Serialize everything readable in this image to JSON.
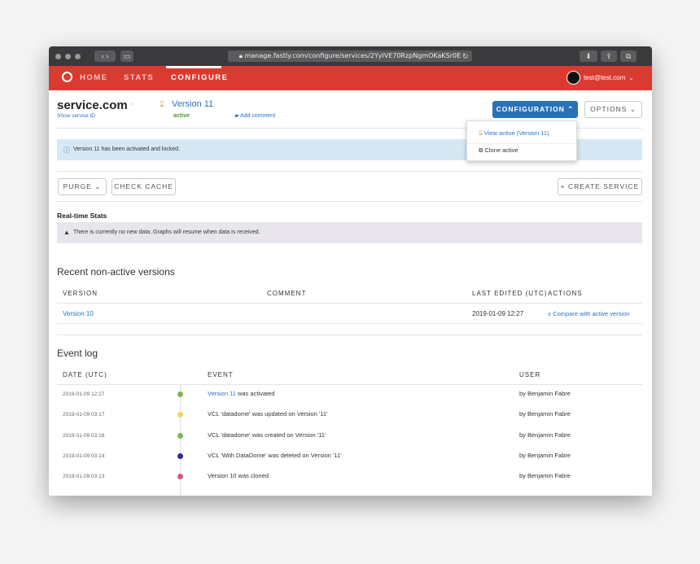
{
  "browser": {
    "url": "manage.fastly.com/configure/services/2YylVE70RzpNgmOKaKSr0E"
  },
  "nav": {
    "items": [
      "HOME",
      "STATS",
      "CONFIGURE"
    ],
    "user_email": "test@test.com"
  },
  "service": {
    "name": "service.com",
    "show_id": "Show service ID",
    "version_label": "Version 11",
    "version_status": "active",
    "add_comment": "Add comment"
  },
  "buttons": {
    "configuration": "CONFIGURATION",
    "options": "OPTIONS",
    "purge": "PURGE",
    "check_cache": "CHECK CACHE",
    "create_service": "CREATE SERVICE"
  },
  "dropdown": {
    "view_active": "View active (Version 11)",
    "clone_active": "Clone active"
  },
  "alerts": {
    "activated": "Version 11 has been activated and locked.",
    "no_data": "There is currently no new data. Graphs will resume when data is received."
  },
  "realtime": {
    "title": "Real-time Stats"
  },
  "recent": {
    "title": "Recent non-active versions",
    "headers": [
      "VERSION",
      "COMMENT",
      "LAST EDITED (UTC)",
      "ACTIONS"
    ],
    "rows": [
      {
        "version": "Version 10",
        "comment": "",
        "edited": "2019-01-09 12:27",
        "action": "Compare with active version"
      }
    ]
  },
  "eventlog": {
    "title": "Event log",
    "headers": [
      "DATE (UTC)",
      "EVENT",
      "USER"
    ],
    "rows": [
      {
        "date": "2019-01-09 12:27",
        "event_link": "Version 11",
        "event": " was activated",
        "user": "by Benjamin Fabre",
        "color": "#7fb35a"
      },
      {
        "date": "2019-01-09 03:17",
        "event_link": "",
        "event": "VCL 'datadome' was updated on Version '11'",
        "user": "by Benjamin Fabre",
        "color": "#f3d35a"
      },
      {
        "date": "2019-01-09 03:16",
        "event_link": "",
        "event": "VCL 'datadome' was created on Version '11'",
        "user": "by Benjamin Fabre",
        "color": "#7fb35a"
      },
      {
        "date": "2019-01-09 03:14",
        "event_link": "",
        "event": "VCL 'With DataDome' was deleted on Version '11'",
        "user": "by Benjamin Fabre",
        "color": "#2d2f8f"
      },
      {
        "date": "2019-01-09 03:13",
        "event_link": "",
        "event": "Version 10 was cloned",
        "user": "by Benjamin Fabre",
        "color": "#d65a7c"
      }
    ]
  },
  "colors": {
    "nav_red": "#da3a30",
    "primary_blue": "#2a72b7",
    "link_blue": "#2a73c5",
    "active_green": "#4a9b2f"
  }
}
